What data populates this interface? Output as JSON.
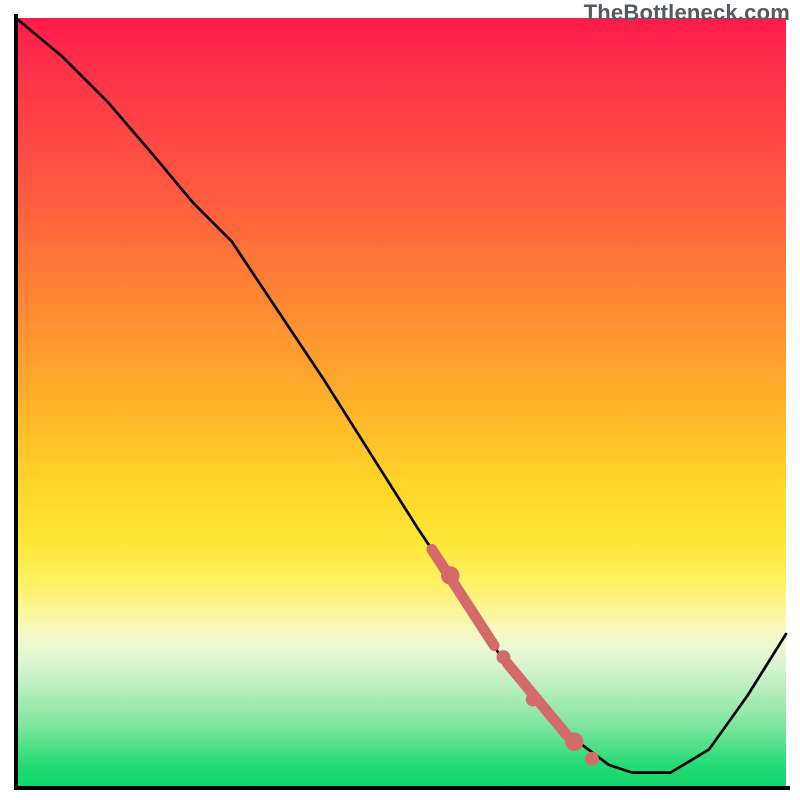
{
  "watermark": "TheBottleneck.com",
  "chart_data": {
    "type": "line",
    "title": "",
    "xlabel": "",
    "ylabel": "",
    "xlim": [
      0,
      100
    ],
    "ylim": [
      0,
      100
    ],
    "grid": false,
    "legend": false,
    "background": "red-yellow-green vertical gradient",
    "series": [
      {
        "name": "curve",
        "color": "#000000",
        "x": [
          0,
          6,
          12,
          18,
          23,
          28,
          40,
          52,
          58,
          63,
          68,
          73,
          77,
          80,
          85,
          90,
          95,
          100
        ],
        "y": [
          100,
          95,
          89,
          82,
          76,
          71,
          53,
          34,
          25,
          17,
          11,
          6,
          3,
          2,
          2,
          5,
          12,
          20
        ]
      }
    ],
    "markers": [
      {
        "cx": 56.4,
        "cy": 27.6,
        "r": 1.2
      },
      {
        "cx": 63.3,
        "cy": 17.0,
        "r": 0.9
      },
      {
        "cx": 67.1,
        "cy": 11.5,
        "r": 0.9
      },
      {
        "cx": 72.5,
        "cy": 6.0,
        "r": 1.2
      },
      {
        "cx": 74.8,
        "cy": 3.8,
        "r": 0.9
      }
    ],
    "thick_segments": [
      {
        "x1": 54.0,
        "y1": 31.0,
        "x2": 62.1,
        "y2": 18.5
      },
      {
        "x1": 63.8,
        "y1": 16.2,
        "x2": 71.6,
        "y2": 6.8
      }
    ]
  }
}
